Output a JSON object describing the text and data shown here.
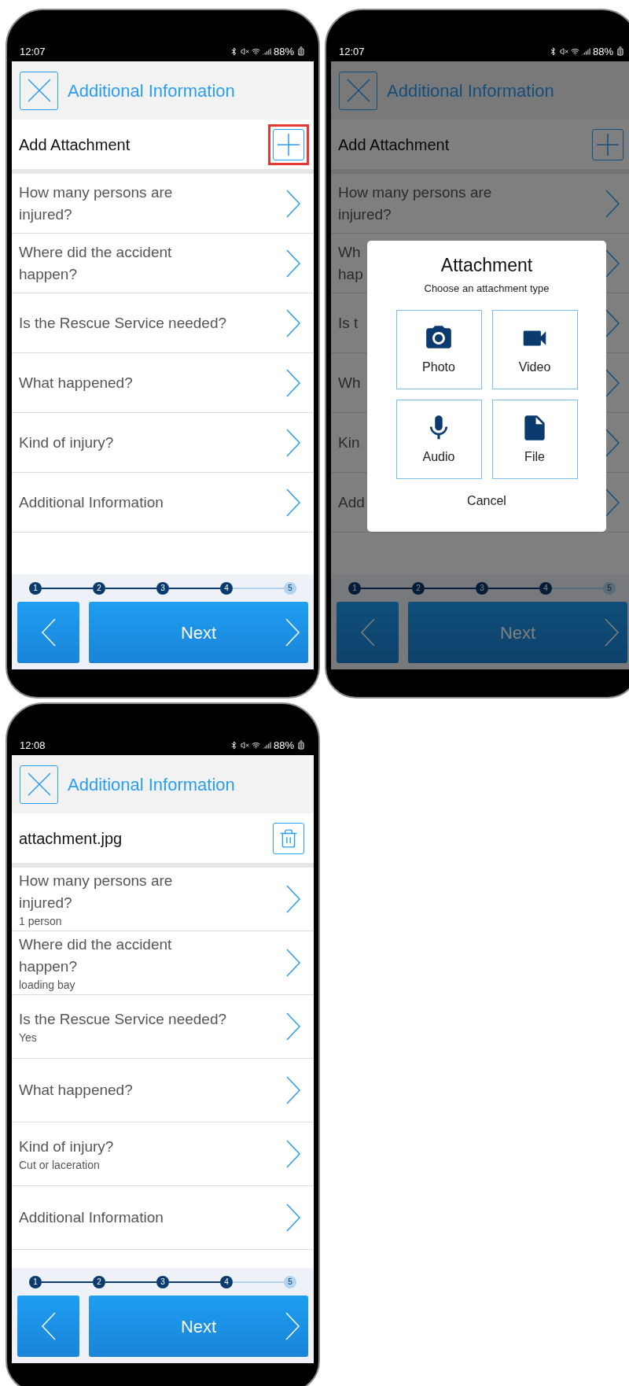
{
  "screens": [
    {
      "dimmed": false,
      "status_bar": {
        "time": "12:07",
        "battery": "88%"
      },
      "header": {
        "title": "Additional Information"
      },
      "attachment": {
        "kind": "add",
        "label": "Add Attachment",
        "highlighted": true
      },
      "questions": [
        {
          "lines": [
            "How many persons are",
            "injured?"
          ]
        },
        {
          "lines": [
            "Where did the accident",
            "happen?"
          ]
        },
        {
          "lines": [
            "Is the Rescue Service needed?"
          ]
        },
        {
          "lines": [
            "What happened?"
          ]
        },
        {
          "lines": [
            "Kind of injury?"
          ]
        },
        {
          "lines": [
            "Additional Information"
          ]
        }
      ],
      "stepper": [
        {
          "label": "1",
          "done": true
        },
        {
          "label": "2",
          "done": true
        },
        {
          "label": "3",
          "done": true
        },
        {
          "label": "4",
          "done": true
        },
        {
          "label": "5",
          "done": false
        }
      ],
      "next_button": "Next"
    },
    {
      "dimmed": true,
      "status_bar": {
        "time": "12:07",
        "battery": "88%"
      },
      "header": {
        "title": "Additional Information"
      },
      "attachment": {
        "kind": "add",
        "label": "Add Attachment",
        "highlighted": false
      },
      "questions": [
        {
          "lines": [
            "How many persons are",
            "injured?"
          ]
        },
        {
          "lines": [
            "Wh",
            "hap"
          ]
        },
        {
          "lines": [
            "Is t"
          ]
        },
        {
          "lines": [
            "Wh"
          ]
        },
        {
          "lines": [
            "Kin"
          ]
        },
        {
          "lines": [
            "Add"
          ]
        }
      ],
      "stepper": [
        {
          "label": "1",
          "done": true
        },
        {
          "label": "2",
          "done": true
        },
        {
          "label": "3",
          "done": true
        },
        {
          "label": "4",
          "done": true
        },
        {
          "label": "5",
          "done": false
        }
      ],
      "next_button": "Next",
      "dialog": {
        "title": "Attachment",
        "subtitle": "Choose an attachment type",
        "options": [
          {
            "kind": "photo",
            "label": "Photo"
          },
          {
            "kind": "video",
            "label": "Video"
          },
          {
            "kind": "audio",
            "label": "Audio"
          },
          {
            "kind": "file",
            "label": "File"
          }
        ],
        "cancel": "Cancel"
      }
    },
    {
      "dimmed": false,
      "status_bar": {
        "time": "12:08",
        "battery": "88%"
      },
      "header": {
        "title": "Additional Information"
      },
      "attachment": {
        "kind": "file",
        "label": "attachment.jpg",
        "highlighted": false
      },
      "questions": [
        {
          "lines": [
            "How many persons are",
            "injured?"
          ],
          "value": "1 person"
        },
        {
          "lines": [
            "Where did the accident",
            "happen?"
          ],
          "value": "loading bay"
        },
        {
          "lines": [
            "Is the Rescue Service needed?"
          ],
          "value": "Yes"
        },
        {
          "lines": [
            "What happened?"
          ]
        },
        {
          "lines": [
            "Kind of injury?"
          ],
          "value": "Cut or laceration"
        },
        {
          "lines": [
            "Additional Information"
          ]
        }
      ],
      "stepper": [
        {
          "label": "1",
          "done": true
        },
        {
          "label": "2",
          "done": true
        },
        {
          "label": "3",
          "done": true
        },
        {
          "label": "4",
          "done": true
        },
        {
          "label": "5",
          "done": false
        }
      ],
      "next_button": "Next"
    }
  ]
}
